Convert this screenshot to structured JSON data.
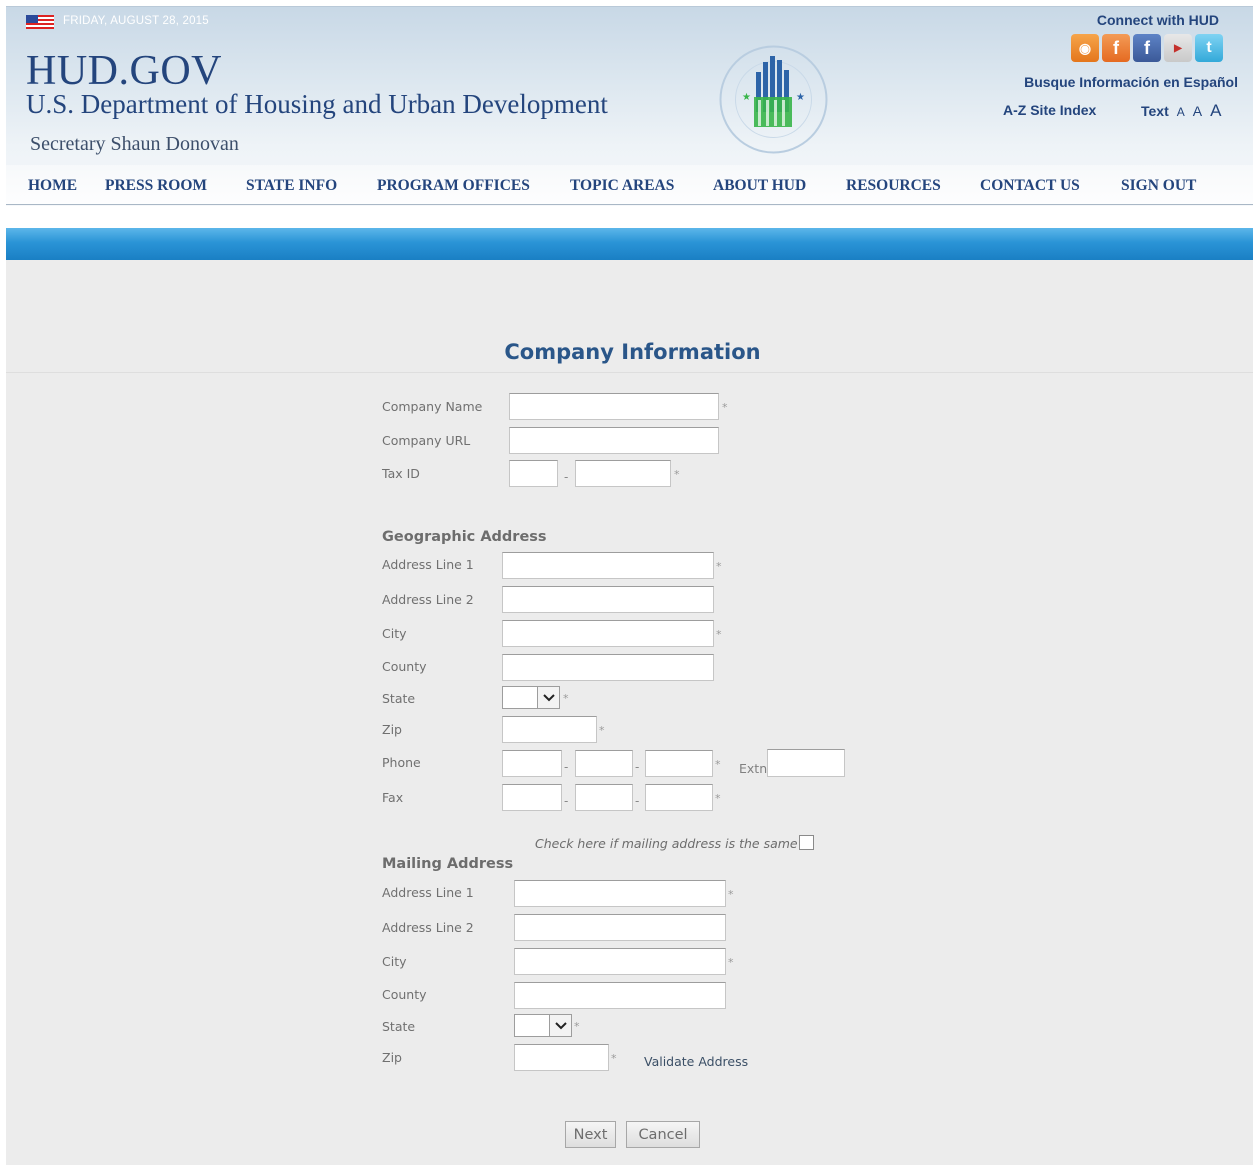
{
  "header": {
    "date": "FRIDAY, AUGUST 28, 2015",
    "site_name": "HUD.GOV",
    "agency_name": "U.S. Department of Housing and Urban Development",
    "secretary": "Secretary Shaun Donovan",
    "connect_label": "Connect with HUD",
    "social_icons": [
      "rss-icon",
      "facebook-icon",
      "facebook-icon",
      "youtube-icon",
      "twitter-icon"
    ],
    "espanol_link": "Busque Información en Español",
    "az_index_link": "A-Z Site Index",
    "text_size": {
      "label": "Text",
      "small": "A",
      "medium": "A",
      "large": "A"
    }
  },
  "nav": {
    "items": [
      "HOME",
      "PRESS ROOM",
      "STATE INFO",
      "PROGRAM OFFICES",
      "TOPIC AREAS",
      "ABOUT HUD",
      "RESOURCES",
      "CONTACT US",
      "SIGN OUT"
    ]
  },
  "colors": {
    "brand_blue": "#24457d",
    "title_blue": "#2a5689",
    "band_blue": "#1a7fc4",
    "background": "#ececec"
  },
  "form": {
    "title": "Company Information",
    "company": {
      "name_label": "Company Name",
      "name_value": "",
      "url_label": "Company URL",
      "url_value": "",
      "tax_id_label": "Tax ID",
      "tax_id_part1": "",
      "tax_id_part2": ""
    },
    "geographic": {
      "section_title": "Geographic Address",
      "address1_label": "Address Line 1",
      "address2_label": "Address Line 2",
      "city_label": "City",
      "county_label": "County",
      "state_label": "State",
      "state_value": "",
      "zip_label": "Zip",
      "phone_label": "Phone",
      "extn_label": "Extn",
      "fax_label": "Fax"
    },
    "same_address_label": "Check here if mailing address is the same",
    "mailing": {
      "section_title": "Mailing Address",
      "address1_label": "Address Line 1",
      "address2_label": "Address Line 2",
      "city_label": "City",
      "county_label": "County",
      "state_label": "State",
      "state_value": "",
      "zip_label": "Zip",
      "validate_link": "Validate Address"
    },
    "required_marker": "*",
    "separator": "-",
    "buttons": {
      "next": "Next",
      "cancel": "Cancel"
    }
  }
}
